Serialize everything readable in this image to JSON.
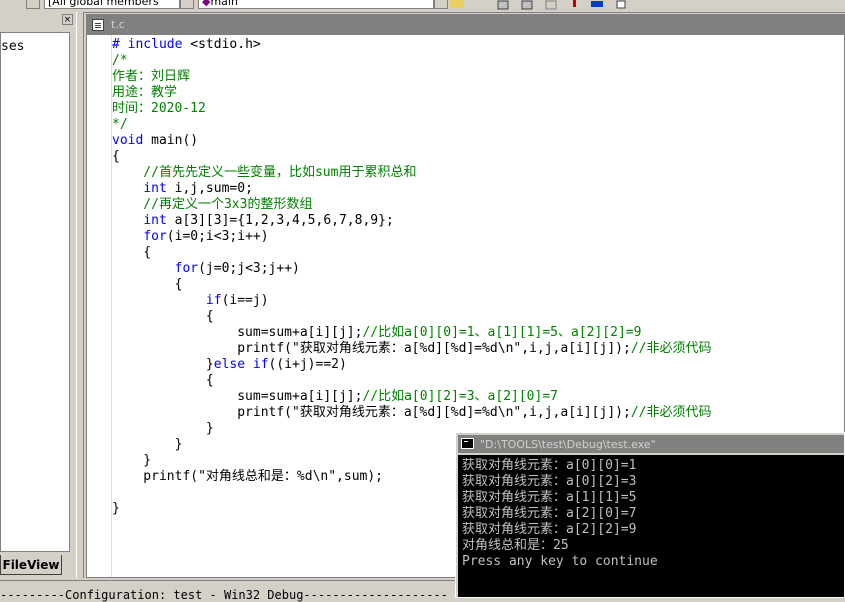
{
  "toolbar": {
    "class_combo": "[All global members",
    "member_combo": "main"
  },
  "workspace": {
    "close_glyph": "×",
    "tree_fragment": "ses",
    "tab_label": "FileView"
  },
  "editor": {
    "title": "t.c",
    "lines": [
      [
        {
          "t": "# include ",
          "c": "kw"
        },
        {
          "t": "<stdio.h>",
          "c": "n"
        }
      ],
      [
        {
          "t": "/*",
          "c": "cm"
        }
      ],
      [
        {
          "t": "作者：刘日辉",
          "c": "cm"
        }
      ],
      [
        {
          "t": "用途：教学",
          "c": "cm"
        }
      ],
      [
        {
          "t": "时间：2020-12",
          "c": "cm"
        }
      ],
      [
        {
          "t": "*/",
          "c": "cm"
        }
      ],
      [
        {
          "t": "void",
          "c": "kw"
        },
        {
          "t": " main()",
          "c": "n"
        }
      ],
      [
        {
          "t": "{",
          "c": "n"
        }
      ],
      [
        {
          "t": "    //首先先定义一些变量，比如sum用于累积总和",
          "c": "cm"
        }
      ],
      [
        {
          "t": "    ",
          "c": "n"
        },
        {
          "t": "int",
          "c": "kw"
        },
        {
          "t": " i,j,sum=0;",
          "c": "n"
        }
      ],
      [
        {
          "t": "    //再定义一个3x3的整形数组",
          "c": "cm"
        }
      ],
      [
        {
          "t": "    ",
          "c": "n"
        },
        {
          "t": "int",
          "c": "kw"
        },
        {
          "t": " a[3][3]={1,2,3,4,5,6,7,8,9};",
          "c": "n"
        }
      ],
      [
        {
          "t": "    ",
          "c": "n"
        },
        {
          "t": "for",
          "c": "kw"
        },
        {
          "t": "(i=0;i<3;i++)",
          "c": "n"
        }
      ],
      [
        {
          "t": "    {",
          "c": "n"
        }
      ],
      [
        {
          "t": "        ",
          "c": "n"
        },
        {
          "t": "for",
          "c": "kw"
        },
        {
          "t": "(j=0;j<3;j++)",
          "c": "n"
        }
      ],
      [
        {
          "t": "        {",
          "c": "n"
        }
      ],
      [
        {
          "t": "            ",
          "c": "n"
        },
        {
          "t": "if",
          "c": "kw"
        },
        {
          "t": "(i==j)",
          "c": "n"
        }
      ],
      [
        {
          "t": "            {",
          "c": "n"
        }
      ],
      [
        {
          "t": "                sum=sum+a[i][j];",
          "c": "n"
        },
        {
          "t": "//比如a[0][0]=1、a[1][1]=5、a[2][2]=9",
          "c": "cm"
        }
      ],
      [
        {
          "t": "                printf(\"获取对角线元素：a[%d][%d]=%d\\n\",i,j,a[i][j]);",
          "c": "n"
        },
        {
          "t": "//非必须代码",
          "c": "cm"
        }
      ],
      [
        {
          "t": "            }",
          "c": "n"
        },
        {
          "t": "else",
          "c": "kw"
        },
        {
          "t": " ",
          "c": "n"
        },
        {
          "t": "if",
          "c": "kw"
        },
        {
          "t": "((i+j)==2)",
          "c": "n"
        }
      ],
      [
        {
          "t": "            {",
          "c": "n"
        }
      ],
      [
        {
          "t": "                sum=sum+a[i][j];",
          "c": "n"
        },
        {
          "t": "//比如a[0][2]=3、a[2][0]=7",
          "c": "cm"
        }
      ],
      [
        {
          "t": "                printf(\"获取对角线元素：a[%d][%d]=%d\\n\",i,j,a[i][j]);",
          "c": "n"
        },
        {
          "t": "//非必须代码",
          "c": "cm"
        }
      ],
      [
        {
          "t": "            }",
          "c": "n"
        }
      ],
      [
        {
          "t": "        }",
          "c": "n"
        }
      ],
      [
        {
          "t": "    }",
          "c": "n"
        }
      ],
      [
        {
          "t": "    printf(\"对角线总和是：%d\\n\",sum);",
          "c": "n"
        }
      ],
      [
        {
          "t": "",
          "c": "n"
        }
      ],
      [
        {
          "t": "}",
          "c": "n"
        }
      ]
    ]
  },
  "console": {
    "title": "\"D:\\TOOLS\\test\\Debug\\test.exe\"",
    "lines": [
      "获取对角线元素：a[0][0]=1",
      "获取对角线元素：a[0][2]=3",
      "获取对角线元素：a[1][1]=5",
      "获取对角线元素：a[2][0]=7",
      "获取对角线元素：a[2][2]=9",
      "对角线总和是：25",
      "Press any key to continue"
    ]
  },
  "status": {
    "text": "---------Configuration: test - Win32 Debug--------------------"
  },
  "colors": {
    "keyword": "#0000ff",
    "comment": "#008000",
    "console_text": "#c0c0c0"
  }
}
